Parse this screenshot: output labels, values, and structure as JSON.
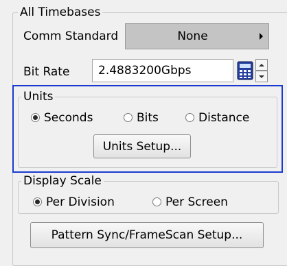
{
  "all_timebases": {
    "title": "All Timebases",
    "comm_standard": {
      "label": "Comm Standard",
      "value": "None"
    },
    "bit_rate": {
      "label": "Bit Rate",
      "value": "2.4883200Gbps"
    }
  },
  "units": {
    "title": "Units",
    "options": [
      "Seconds",
      "Bits",
      "Distance"
    ],
    "selected": "Seconds",
    "setup_button": "Units Setup..."
  },
  "display_scale": {
    "title": "Display Scale",
    "options": [
      "Per Division",
      "Per Screen"
    ],
    "selected": "Per Division"
  },
  "pattern_sync_button": "Pattern Sync/FrameScan Setup...",
  "colors": {
    "focus_border": "#1a3acf",
    "dropdown_bg": "#c4c4c4"
  }
}
